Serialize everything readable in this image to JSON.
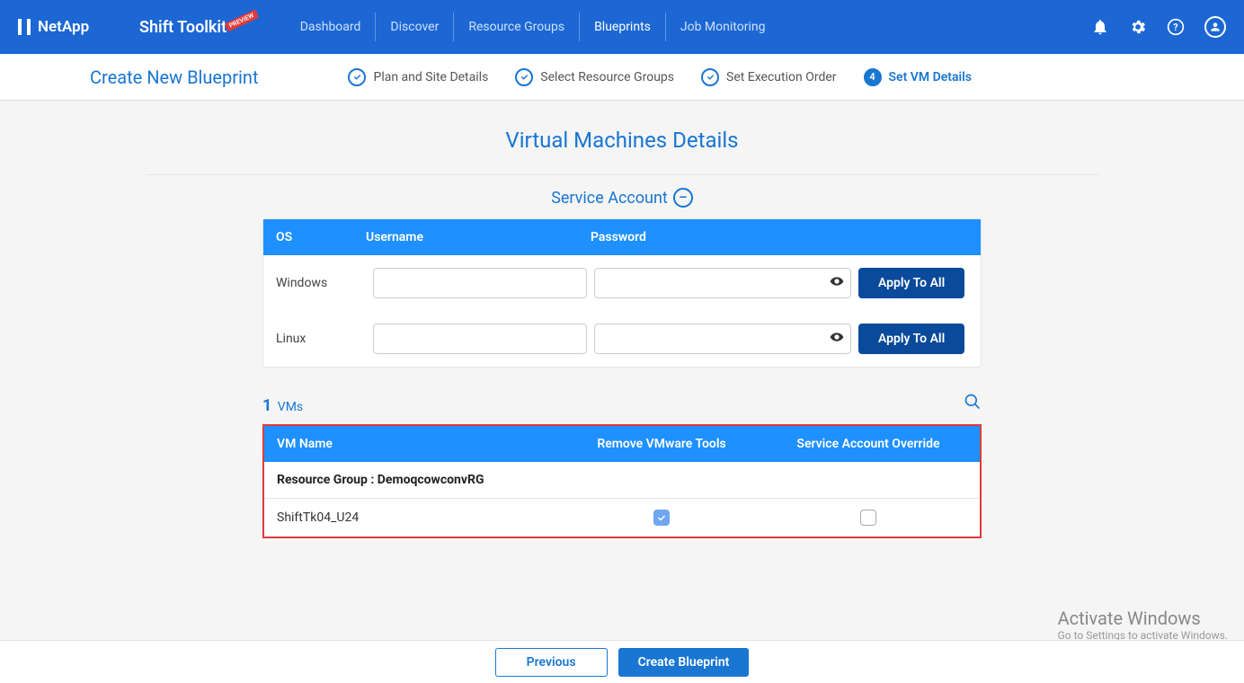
{
  "brand": "NetApp",
  "app_name": "Shift Toolkit",
  "preview_label": "PREVIEW",
  "nav": [
    "Dashboard",
    "Discover",
    "Resource Groups",
    "Blueprints",
    "Job Monitoring"
  ],
  "active_nav_index": 3,
  "page_title": "Create New Blueprint",
  "steps": [
    {
      "label": "Plan and Site Details",
      "state": "done"
    },
    {
      "label": "Select Resource Groups",
      "state": "done"
    },
    {
      "label": "Set Execution Order",
      "state": "done"
    },
    {
      "label": "Set VM Details",
      "state": "active",
      "num": "4"
    }
  ],
  "section_title": "Virtual Machines Details",
  "service_account_title": "Service Account",
  "sa_header": {
    "os": "OS",
    "user": "Username",
    "pass": "Password"
  },
  "sa_rows": [
    {
      "os": "Windows",
      "user": "",
      "pass": "",
      "apply": "Apply To All"
    },
    {
      "os": "Linux",
      "user": "",
      "pass": "",
      "apply": "Apply To All"
    }
  ],
  "vms_count": "1",
  "vms_label": "VMs",
  "vm_header": {
    "name": "VM Name",
    "remove": "Remove VMware Tools",
    "override": "Service Account Override"
  },
  "vm_group_prefix": "Resource Group : ",
  "vm_group_name": "DemoqcowconvRG",
  "vm_rows": [
    {
      "name": "ShiftTk04_U24",
      "remove": true,
      "override": false
    }
  ],
  "footer": {
    "prev": "Previous",
    "create": "Create Blueprint"
  },
  "watermark": {
    "l1": "Activate Windows",
    "l2": "Go to Settings to activate Windows."
  }
}
